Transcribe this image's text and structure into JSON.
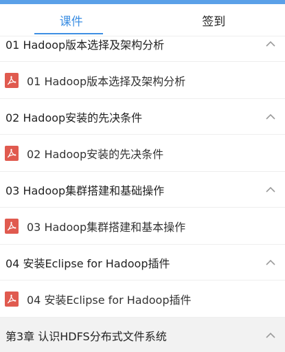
{
  "tabs": [
    {
      "label": "课件",
      "active": true
    },
    {
      "label": "签到",
      "active": false
    }
  ],
  "rows": [
    {
      "kind": "section",
      "label": "01 Hadoop版本选择及架构分析",
      "icon": "chevron-up-icon"
    },
    {
      "kind": "lesson",
      "label": "01 Hadoop版本选择及架构分析",
      "icon": "pdf-icon"
    },
    {
      "kind": "section",
      "label": "02 Hadoop安装的先决条件",
      "icon": "chevron-up-icon"
    },
    {
      "kind": "lesson",
      "label": "02 Hadoop安装的先决条件",
      "icon": "pdf-icon"
    },
    {
      "kind": "section",
      "label": "03 Hadoop集群搭建和基础操作",
      "icon": "chevron-up-icon"
    },
    {
      "kind": "lesson",
      "label": "03 Hadoop集群搭建和基本操作",
      "icon": "pdf-icon"
    },
    {
      "kind": "section",
      "label": "04 安装Eclipse for Hadoop插件",
      "icon": "chevron-up-icon"
    },
    {
      "kind": "lesson",
      "label": "04 安装Eclipse for Hadoop插件",
      "icon": "pdf-icon"
    },
    {
      "kind": "chapter",
      "label": "第3章 认识HDFS分布式文件系统",
      "icon": "chevron-up-icon"
    }
  ],
  "colors": {
    "accent": "#3d8fe3",
    "pdf": "#e05a4f",
    "chapter_bg": "#f2f2f2"
  }
}
